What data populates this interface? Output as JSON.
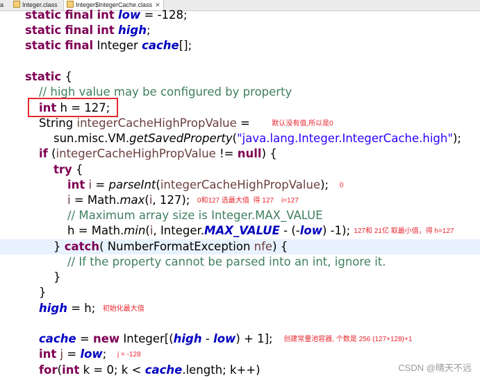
{
  "tabs": [
    {
      "label": "a"
    },
    {
      "label": "Integer.class"
    },
    {
      "label": "Integer$IntegerCache.class",
      "close": "✕"
    }
  ],
  "code": {
    "l1_low": "low",
    "l1_val": " = -128;",
    "l2_high": "high",
    "l3_type": "Integer",
    "l3_cache": "cache",
    "l3_rest": "[];",
    "l5_open": " {",
    "l6_comment": "// high value may be configured by property",
    "l7_rest": " h = 127;",
    "l8_type": "String ",
    "l8_var": "integerCacheHighPropValue",
    "l8_eq": " = ",
    "l9_pre": "sun.misc.VM.",
    "l9_method": "getSavedProperty",
    "l9_str": "\"java.lang.Integer.IntegerCache.high\"",
    "l9_end": ");",
    "l10_if": "if",
    "l10_var": "integerCacheHighPropValue",
    "l10_ne": " != ",
    "l10_null": "null",
    "l10_end": ") {",
    "l11_try": "try",
    "l11_end": " {",
    "l12_var": " i",
    "l12_eq": " = ",
    "l12_method": "parseInt",
    "l12_arg": "integerCacheHighPropValue",
    "l12_end": ");",
    "l13_i": "i",
    "l13_pre": " = Math.",
    "l13_method": "max",
    "l13_i2": "i",
    "l13_end": ", 127);",
    "l14_comment": "// Maximum array size is Integer.MAX_VALUE",
    "l15_h": "h = Math.",
    "l15_method": "min",
    "l15_i": "i",
    "l15_mid": ", Integer.",
    "l15_const": "MAX_VALUE",
    "l15_mid2": " - (-",
    "l15_low": "low",
    "l15_end": ") -1);",
    "l16_close": "} ",
    "l16_catch": "catch",
    "l16_mid": "( NumberFormatException ",
    "l16_nfe": "nfe",
    "l16_end": ") {",
    "l17_comment": "// If the property cannot be parsed into an int, ignore it.",
    "l18_close": "}",
    "l19_close": "}",
    "l20_high": "high",
    "l20_rest": " = h;",
    "l22_cache": "cache",
    "l22_eq": " = ",
    "l22_new": "new",
    "l22_type": " Integer[(",
    "l22_high": "high",
    "l22_minus": " - ",
    "l22_low": "low",
    "l22_end": ") + 1];",
    "l23_var": " j",
    "l23_eq": " = ",
    "l23_low": "low",
    "l23_end": ";",
    "l24_for": "for",
    "l24_open": "(",
    "l24_int": "int",
    "l24_k": " k = 0; k < ",
    "l24_cache": "cache",
    "l24_end": ".length; k++)"
  },
  "keywords": {
    "static": "static",
    "final": "final",
    "int": "int",
    "try": "try",
    "new": "new"
  },
  "annotations": {
    "default_zero": "默认没有值,所以是0",
    "zero": "0",
    "max": "0和127 选最大值  得 127    i=127",
    "min": "127和 21亿 取最小值，得 h=127",
    "init_max": "初始化最大值",
    "create_pool": "创建常量池容器, 个数是 256 (127+128)+1",
    "j_val": "j = -128"
  },
  "watermark": "CSDN @晴天不远",
  "colors": {
    "keyword": "#7f0055",
    "field": "#0000c0",
    "string": "#2a00ff",
    "comment": "#3f7f5f",
    "annotation": "#e8262e",
    "line_highlight": "#e8f2fe"
  }
}
